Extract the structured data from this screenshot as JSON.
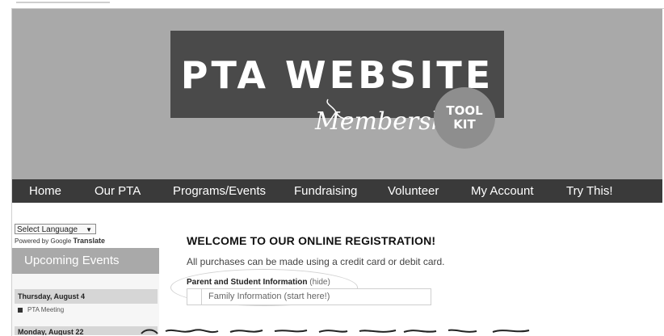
{
  "banner": {
    "logo_title": "PTA WEBSITE",
    "logo_script": "Membership",
    "badge_line1": "TOOL",
    "badge_line2": "KIT"
  },
  "nav": {
    "items": [
      "Home",
      "Our PTA",
      "Programs/Events",
      "Fundraising",
      "Volunteer",
      "My Account",
      "Try This!"
    ]
  },
  "sidebar": {
    "language_select": "Select Language",
    "powered_by": "Powered by",
    "google": "Google",
    "translate": "Translate",
    "upcoming_title": "Upcoming Events",
    "events": [
      {
        "date": "Thursday, August 4",
        "items": [
          "PTA Meeting"
        ]
      },
      {
        "date": "Monday, August 22",
        "items": []
      }
    ]
  },
  "main": {
    "title": "WELCOME TO OUR ONLINE REGISTRATION!",
    "subtitle": "All purchases can be made using a credit card or debit card.",
    "section_label": "Parent and Student Information",
    "hide_link": "(hide)",
    "family_item": "Family Information (start here!)"
  },
  "colors": {
    "banner_bg": "#a9a9a9",
    "logo_bg": "#4a4a4a",
    "nav_bg": "#3a3a3a",
    "badge_bg": "#8e8e8e"
  }
}
